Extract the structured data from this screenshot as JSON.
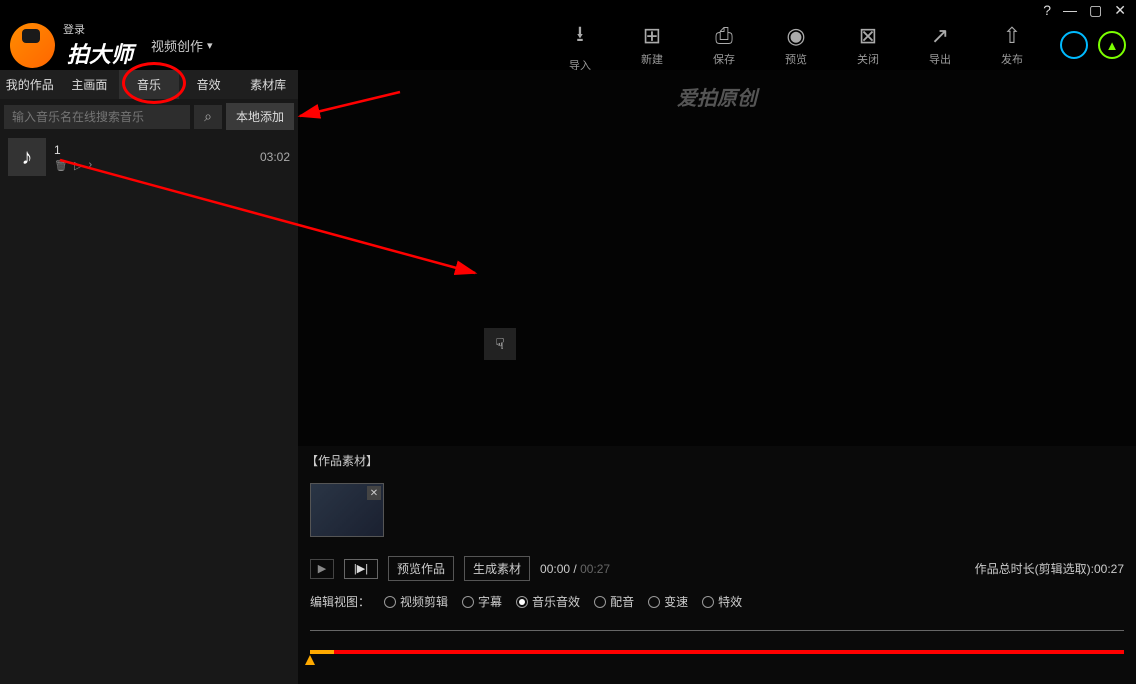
{
  "titlebar": {
    "help": "?"
  },
  "header": {
    "login": "登录",
    "appName": "拍大师",
    "mode": "视频创作",
    "buttons": {
      "import": "导入",
      "new": "新建",
      "save": "保存",
      "preview": "预览",
      "close": "关闭",
      "export": "导出",
      "publish": "发布"
    }
  },
  "sidebar": {
    "tabs": {
      "myWorks": "我的作品",
      "mainScreen": "主画面",
      "music": "音乐",
      "sfx": "音效",
      "library": "素材库"
    },
    "search": {
      "placeholder": "输入音乐名在线搜索音乐"
    },
    "localAdd": "本地添加",
    "track": {
      "title": "1",
      "duration": "03:02"
    }
  },
  "preview": {
    "watermark": "爱拍原创"
  },
  "materials": {
    "label": "【作品素材】"
  },
  "playback": {
    "previewWork": "预览作品",
    "generate": "生成素材",
    "currentTime": "00:00",
    "totalTime": "00:27",
    "totalLabel": "作品总时长(剪辑选取):00:27"
  },
  "edit": {
    "label": "编辑视图：",
    "options": {
      "videoEdit": "视频剪辑",
      "subtitle": "字幕",
      "musicSfx": "音乐音效",
      "dub": "配音",
      "speed": "变速",
      "fx": "特效"
    }
  }
}
